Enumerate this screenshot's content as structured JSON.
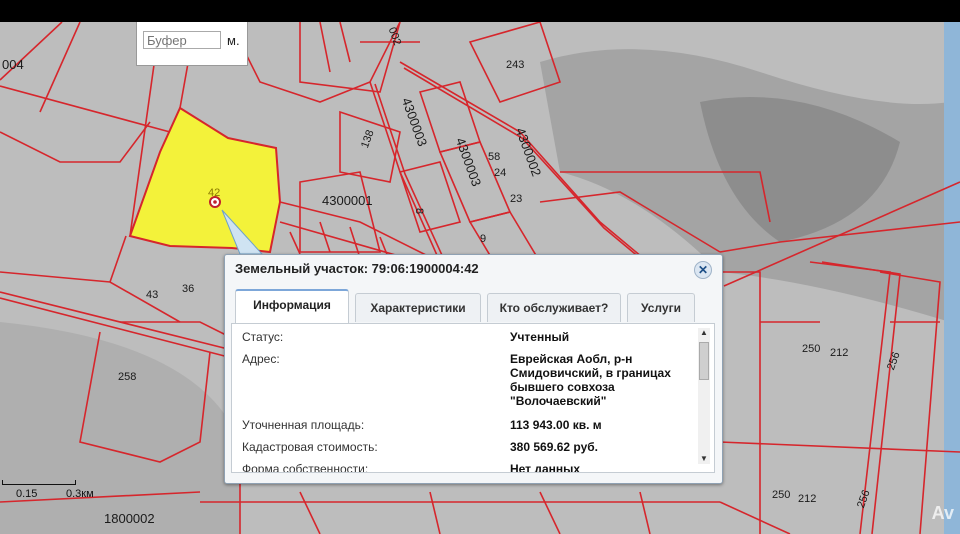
{
  "map": {
    "buffer": {
      "placeholder": "Буфер",
      "unit": "м."
    },
    "labels": {
      "l_004": "004",
      "l_002": "002",
      "l_243": "243",
      "l_138": "138",
      "l_4300003a": "4300003",
      "l_4300003b": "4300003",
      "l_4300002": "4300002",
      "l_58": "58",
      "l_24": "24",
      "l_23": "23",
      "l_9": "9",
      "l_8": "8",
      "l_4300001": "4300001",
      "l_42": "42",
      "l_43": "43",
      "l_36": "36",
      "l_258": "258",
      "l_250a": "250",
      "l_212a": "212",
      "l_256a": "256",
      "l_250b": "250",
      "l_212b": "212",
      "l_256b": "256",
      "l_1800002": "1800002"
    },
    "scale": {
      "left": "0.15",
      "right": "0.3км"
    },
    "watermark": "Av"
  },
  "popup": {
    "title": "Земельный участок: 79:06:1900004:42",
    "close_icon": "close-icon",
    "tabs": [
      {
        "label": "Информация",
        "active": true
      },
      {
        "label": "Характеристики",
        "active": false
      },
      {
        "label": "Кто обслуживает?",
        "active": false
      },
      {
        "label": "Услуги",
        "active": false
      }
    ],
    "fields": {
      "status_label": "Статус:",
      "status_value": "Учтенный",
      "address_label": "Адрес:",
      "address_value_1": "Еврейская Аобл, р-н",
      "address_value_2": "Смидовичский, в границах",
      "address_value_3": "бывшего совхоза",
      "address_value_4": "\"Волочаевский\"",
      "area_label": "Уточненная площадь:",
      "area_value": "113 943.00 кв. м",
      "cost_label": "Кадастровая стоимость:",
      "cost_value": "380 569.62 руб.",
      "ownership_label": "Форма собственности:",
      "ownership_value": "Нет данных"
    }
  },
  "colors": {
    "parcel_line": "#d6262c",
    "highlight": "#f3f23a",
    "tab_accent": "#7da7d9"
  }
}
